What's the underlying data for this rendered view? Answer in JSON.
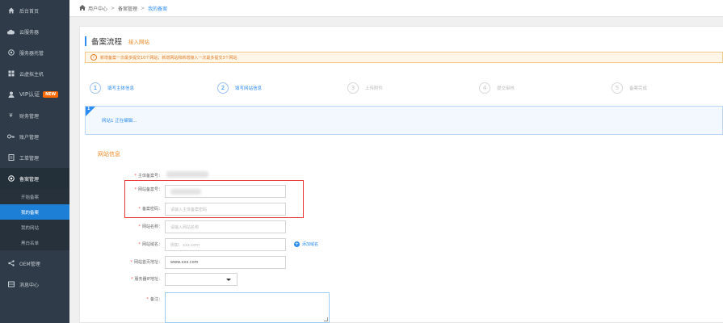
{
  "sidebar": {
    "items": [
      {
        "label": "后台首页",
        "icon": "home-icon"
      },
      {
        "label": "云服务器",
        "icon": "cloud-icon"
      },
      {
        "label": "服务器托管",
        "icon": "server-icon"
      },
      {
        "label": "云虚拟主机",
        "icon": "grid-icon"
      },
      {
        "label": "VIP认证",
        "icon": "user-icon",
        "badge": "NEW"
      },
      {
        "label": "财务管理",
        "icon": "yen-icon"
      },
      {
        "label": "账户管理",
        "icon": "key-icon"
      },
      {
        "label": "工单管理",
        "icon": "ticket-icon"
      },
      {
        "label": "备案管理",
        "icon": "shield-icon"
      }
    ],
    "subitems": [
      {
        "label": "开始备案"
      },
      {
        "label": "我的备案"
      },
      {
        "label": "我的网站"
      },
      {
        "label": "黑白名单"
      }
    ],
    "bottom_items": [
      {
        "label": "OEM管理",
        "icon": "share-icon"
      },
      {
        "label": "消息中心",
        "icon": "message-icon"
      }
    ]
  },
  "breadcrumb": {
    "home": "用户中心",
    "sep": ">",
    "middle": "备案管理",
    "current": "我的备案"
  },
  "header": {
    "title": "备案流程",
    "subtitle": "接入网站"
  },
  "notice": {
    "text": "新增备案一次最多提交10个网站；新增网站和新增接入一次最多提交3个网站"
  },
  "steps": [
    {
      "num": "1",
      "label": "填写主体信息"
    },
    {
      "num": "2",
      "label": "填写网站信息"
    },
    {
      "num": "3",
      "label": "上传附件"
    },
    {
      "num": "4",
      "label": "提交审核"
    },
    {
      "num": "5",
      "label": "备案完成"
    }
  ],
  "site_bar": {
    "corner": "1",
    "text": "网站1 正在编辑..."
  },
  "section": {
    "title": "网站信息"
  },
  "form": {
    "subject_no": {
      "label": "主体备案号："
    },
    "site_no": {
      "label": "网站备案号："
    },
    "password": {
      "label": "备案密码：",
      "placeholder": "请输入主体备案密码"
    },
    "site_name": {
      "label": "网站名称：",
      "placeholder": "请输入网站名称"
    },
    "domain": {
      "label": "网站域名：",
      "placeholder": "例如：xxx.com"
    },
    "add_domain": "添加域名",
    "homepage": {
      "label": "网站首页地址：",
      "value": "www.xxx.com"
    },
    "server_ip": {
      "label": "服务器IP地址："
    },
    "remark": {
      "label": "备注："
    }
  },
  "colors": {
    "sidebar_bg": "#2f3b48",
    "accent": "#2d8cf0",
    "orange": "#f08a24",
    "highlight": "#e8393b"
  }
}
